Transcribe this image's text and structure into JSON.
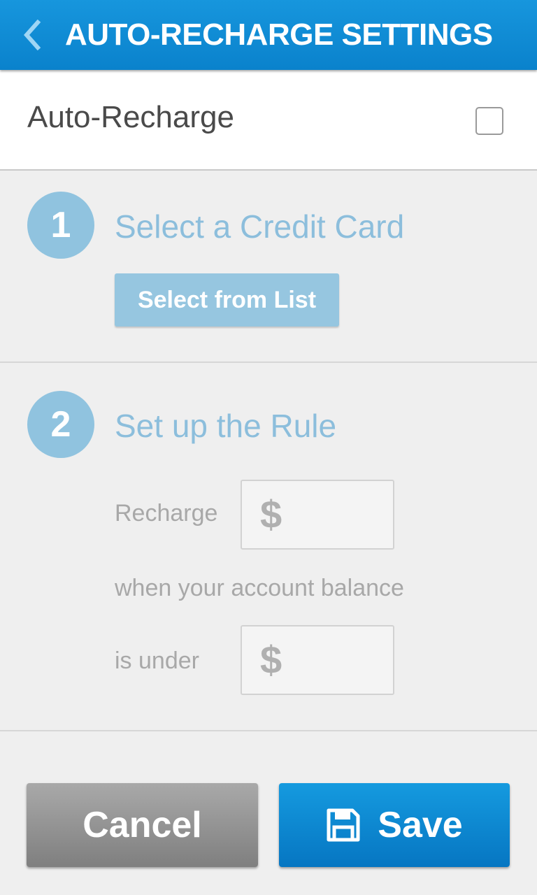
{
  "header": {
    "title": "AUTO-RECHARGE SETTINGS",
    "back_icon": "chevron-left-icon"
  },
  "auto_recharge": {
    "label": "Auto-Recharge",
    "checked": false
  },
  "step1": {
    "number": "1",
    "title": "Select a Credit Card",
    "button_label": "Select from List"
  },
  "step2": {
    "number": "2",
    "title": "Set up the Rule",
    "recharge_label": "Recharge",
    "recharge_prefix": "$",
    "recharge_value": "",
    "balance_text": "when your account balance",
    "under_label": "is under",
    "under_prefix": "$",
    "under_value": ""
  },
  "actions": {
    "cancel_label": "Cancel",
    "save_label": "Save",
    "save_icon": "floppy-disk-icon"
  },
  "colors": {
    "primary": "#0a82cc",
    "step_accent": "#90c3df",
    "cancel": "#8f8f8f"
  }
}
